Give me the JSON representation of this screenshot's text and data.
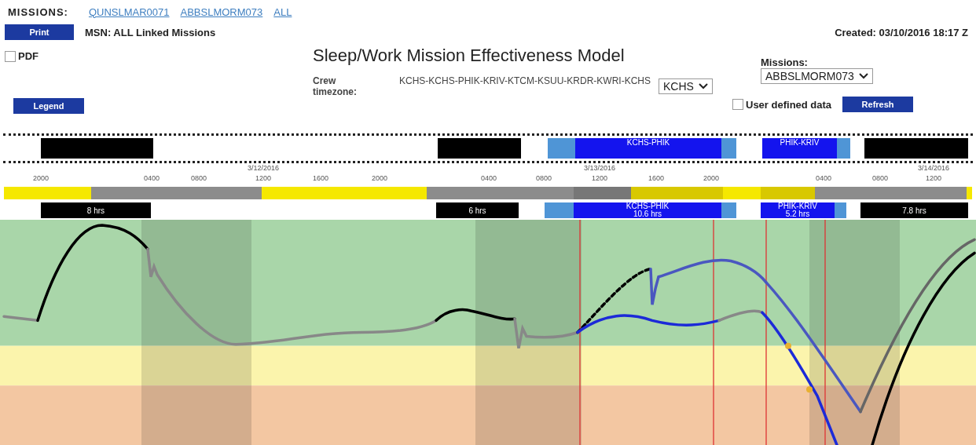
{
  "missions_bar": {
    "label": "MISSIONS:",
    "links": [
      "QUNSLMAR0071",
      "ABBSLMORM073",
      "ALL"
    ]
  },
  "print_button": "Print",
  "msn": "MSN: ALL Linked Missions",
  "created": "Created: 03/10/2016 18:17 Z",
  "pdf": {
    "label": "PDF",
    "checked": false
  },
  "title": "Sleep/Work Mission Effectiveness Model",
  "crew_timezone": {
    "label": "Crew timezone:",
    "route": "KCHS-KCHS-PHIK-KRIV-KTCM-KSUU-KRDR-KWRI-KCHS",
    "value": "KCHS"
  },
  "missions_select": {
    "label": "Missions:",
    "value": "ABBSLMORM073"
  },
  "legend_button": "Legend",
  "user_defined": {
    "label": "User defined data",
    "checked": false
  },
  "refresh_button": "Refresh",
  "schedule": [
    {
      "kind": "sleep"
    },
    {
      "kind": "sleep"
    },
    {
      "kind": "flight",
      "label": "KCHS-PHIK"
    },
    {
      "kind": "flight",
      "label": "PHIK-KRIV"
    },
    {
      "kind": "sleep"
    }
  ],
  "ticks": [
    {
      "label": "2000"
    },
    {
      "label": "0400"
    },
    {
      "label": "0800"
    },
    {
      "label": "1200",
      "date": "3/12/2016"
    },
    {
      "label": "1600"
    },
    {
      "label": "2000"
    },
    {
      "label": "0400"
    },
    {
      "label": "0800"
    },
    {
      "label": "1200",
      "date": "3/13/2016"
    },
    {
      "label": "1600"
    },
    {
      "label": "2000"
    },
    {
      "label": "0400"
    },
    {
      "label": "0800"
    },
    {
      "label": "1200",
      "date": "3/14/2016"
    }
  ],
  "work_bar": [
    {
      "color": "#f5e800"
    },
    {
      "color": "#8c8c8c"
    },
    {
      "color": "#f5e800"
    },
    {
      "color": "#8c8c8c"
    },
    {
      "color": "#777777"
    },
    {
      "color": "#d8c800"
    },
    {
      "color": "#f5e800"
    },
    {
      "color": "#d8c800"
    },
    {
      "color": "#8c8c8c"
    },
    {
      "color": "#f5e800"
    }
  ],
  "duty": [
    {
      "kind": "sleep",
      "label": "8 hrs"
    },
    {
      "kind": "sleep",
      "label": "6 hrs"
    },
    {
      "kind": "flight",
      "label": "KCHS-PHIK",
      "hours": "10.6 hrs"
    },
    {
      "kind": "flight",
      "label": "PHIK-KRIV",
      "hours": "5.2 hrs"
    },
    {
      "kind": "sleep",
      "label": "7.8 hrs"
    }
  ]
}
